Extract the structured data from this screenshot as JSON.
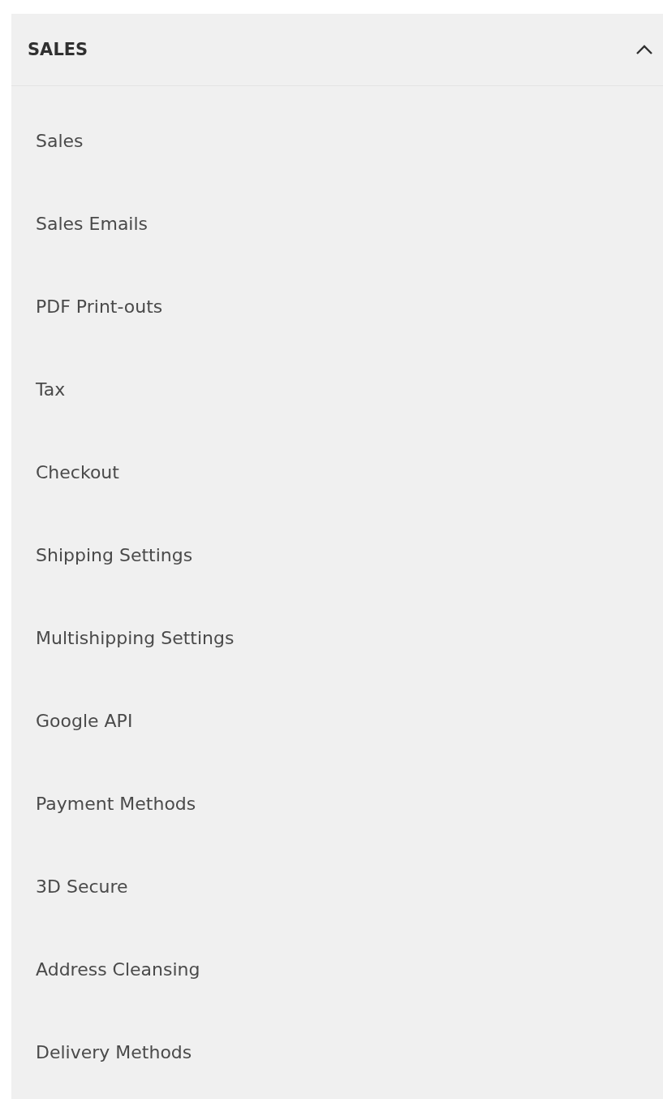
{
  "section": {
    "title": "SALES",
    "expanded": true,
    "items": [
      {
        "label": "Sales"
      },
      {
        "label": "Sales Emails"
      },
      {
        "label": "PDF Print-outs"
      },
      {
        "label": "Tax"
      },
      {
        "label": "Checkout"
      },
      {
        "label": "Shipping Settings"
      },
      {
        "label": "Multishipping Settings"
      },
      {
        "label": "Google API"
      },
      {
        "label": "Payment Methods"
      },
      {
        "label": "3D Secure"
      },
      {
        "label": "Address Cleansing"
      },
      {
        "label": "Delivery Methods"
      }
    ]
  }
}
